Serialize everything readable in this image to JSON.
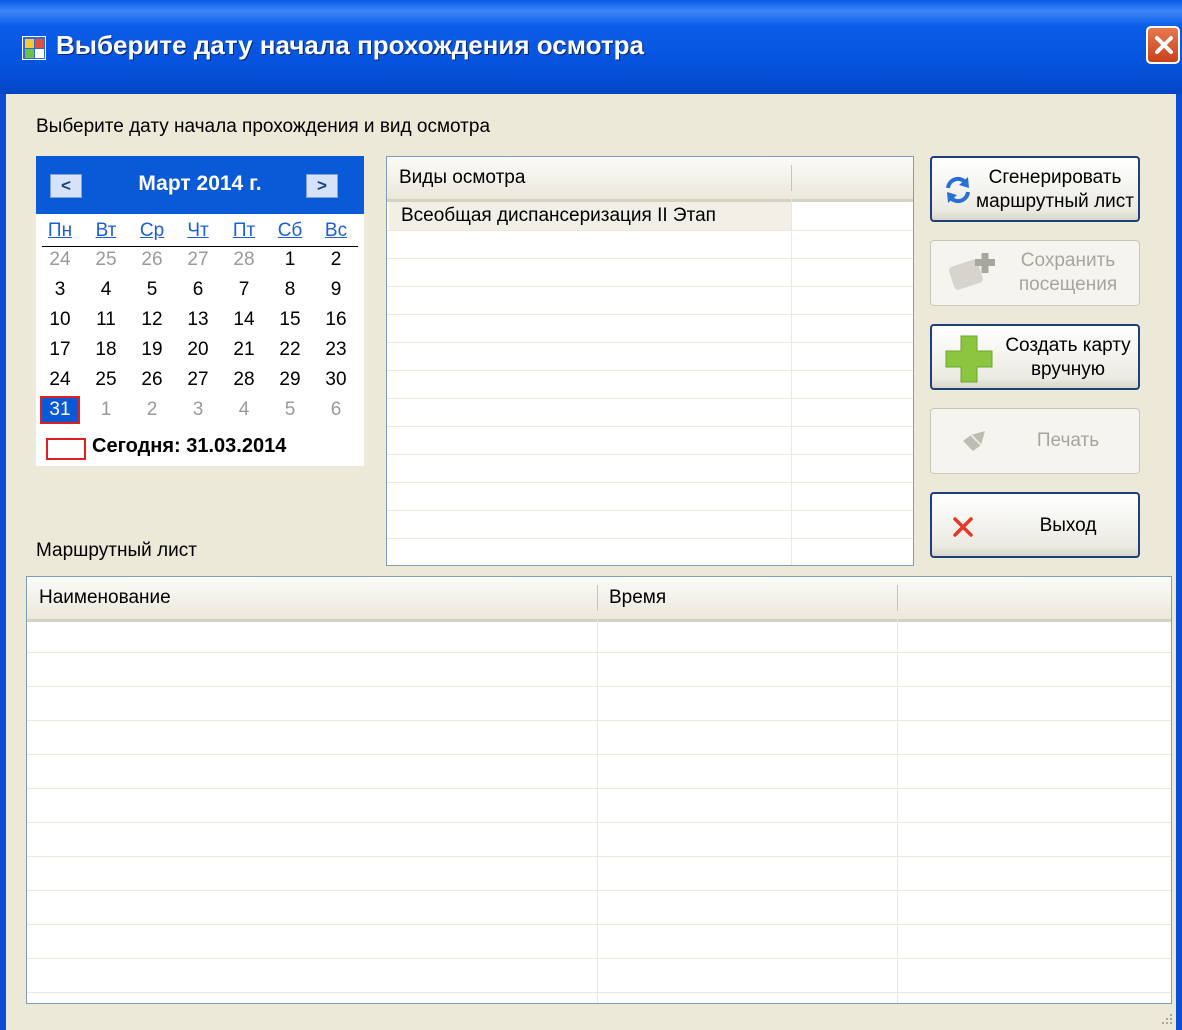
{
  "window": {
    "title": "Выберите дату начала прохождения осмотра"
  },
  "instruction": "Выберите дату начала прохождения и вид осмотра",
  "calendar": {
    "month_label": "Март 2014 г.",
    "prev": "<",
    "next": ">",
    "weekdays": [
      "Пн",
      "Вт",
      "Ср",
      "Чт",
      "Пт",
      "Сб",
      "Вс"
    ],
    "weeks": [
      [
        "24",
        "25",
        "26",
        "27",
        "28",
        "1",
        "2"
      ],
      [
        "3",
        "4",
        "5",
        "6",
        "7",
        "8",
        "9"
      ],
      [
        "10",
        "11",
        "12",
        "13",
        "14",
        "15",
        "16"
      ],
      [
        "17",
        "18",
        "19",
        "20",
        "21",
        "22",
        "23"
      ],
      [
        "24",
        "25",
        "26",
        "27",
        "28",
        "29",
        "30"
      ],
      [
        "31",
        "1",
        "2",
        "3",
        "4",
        "5",
        "6"
      ]
    ],
    "selected": "31",
    "today_label": "Сегодня: 31.03.2014"
  },
  "exam_types": {
    "header": "Виды осмотра",
    "items": [
      "Всеобщая диспансеризация II Этап"
    ]
  },
  "buttons": {
    "generate": [
      "Сгенерировать",
      "маршрутный лист"
    ],
    "save": [
      "Сохранить",
      "посещения"
    ],
    "create": [
      "Создать карту",
      "вручную"
    ],
    "print": [
      "Печать"
    ],
    "exit": [
      "Выход"
    ]
  },
  "route_sheet": {
    "label": "Маршрутный лист",
    "columns": [
      "Наименование",
      "Время"
    ]
  },
  "colors": {
    "title_bar": "#0553dd",
    "calendar_header": "#0a5ad8",
    "window_bg": "#ece9d8",
    "today_frame": "#e02020"
  }
}
